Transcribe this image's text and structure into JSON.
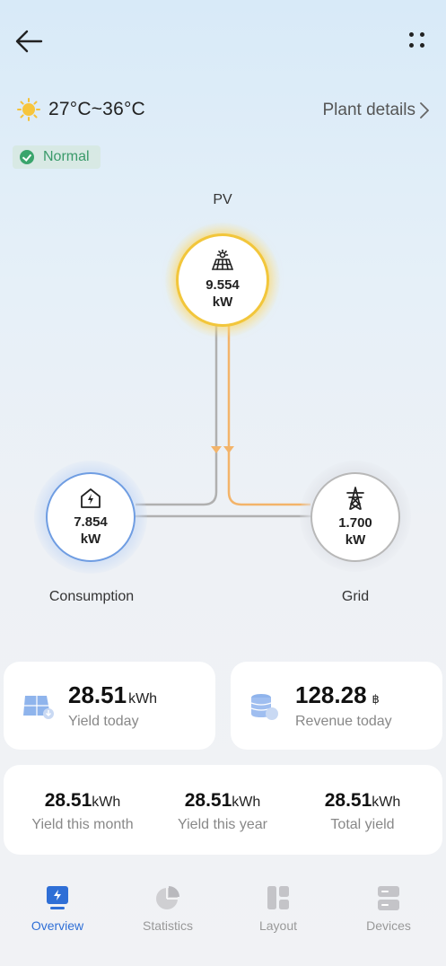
{
  "header": {
    "back_icon": "arrow-left-icon",
    "more_icon": "more-dots-icon"
  },
  "weather": {
    "icon": "sun-icon",
    "range": "27°C~36°C"
  },
  "plant_details": {
    "label": "Plant details",
    "icon": "chevron-right-icon"
  },
  "status": {
    "label": "Normal",
    "color": "#3aa56c"
  },
  "flow": {
    "pv": {
      "label": "PV",
      "value": "9.554",
      "unit": "kW",
      "icon": "solar-panel-icon",
      "ring_color": "#f2c63b"
    },
    "consumption": {
      "label": "Consumption",
      "value": "7.854",
      "unit": "kW",
      "icon": "home-lightning-icon",
      "ring_color": "#6f9de2"
    },
    "grid": {
      "label": "Grid",
      "value": "1.700",
      "unit": "kW",
      "icon": "power-tower-icon",
      "ring_color": "#b8b8b8"
    }
  },
  "cards": {
    "yield_today": {
      "value": "28.51",
      "unit": "kWh",
      "label": "Yield today",
      "icon": "solar-panel-icon"
    },
    "revenue_today": {
      "value": "128.28",
      "unit": "฿",
      "label": "Revenue today",
      "icon": "coins-icon"
    }
  },
  "totals": [
    {
      "value": "28.51",
      "unit": "kWh",
      "label": "Yield this month"
    },
    {
      "value": "28.51",
      "unit": "kWh",
      "label": "Yield this year"
    },
    {
      "value": "28.51",
      "unit": "kWh",
      "label": "Total yield"
    }
  ],
  "tabs": [
    {
      "label": "Overview",
      "icon": "overview-icon",
      "active": true
    },
    {
      "label": "Statistics",
      "icon": "pie-chart-icon",
      "active": false
    },
    {
      "label": "Layout",
      "icon": "layout-icon",
      "active": false
    },
    {
      "label": "Devices",
      "icon": "devices-icon",
      "active": false
    }
  ],
  "colors": {
    "accent": "#2f6fd6",
    "pv_flow": "#f3b46a",
    "grid_flow": "#b0b0b0"
  }
}
